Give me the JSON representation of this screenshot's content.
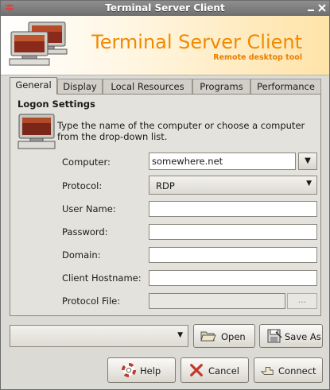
{
  "window": {
    "title": "Terminal Server Client"
  },
  "banner": {
    "title": "Terminal Server Client",
    "subtitle": "Remote desktop tool"
  },
  "tabs": [
    {
      "label": "General",
      "active": true
    },
    {
      "label": "Display",
      "active": false
    },
    {
      "label": "Local Resources",
      "active": false
    },
    {
      "label": "Programs",
      "active": false
    },
    {
      "label": "Performance",
      "active": false
    }
  ],
  "logon": {
    "section_title": "Logon Settings",
    "info": "Type the name of the computer or choose a computer from the drop-down list.",
    "fields": {
      "computer": {
        "label": "Computer:",
        "value": "somewhere.net"
      },
      "protocol": {
        "label": "Protocol:",
        "value": "RDP"
      },
      "username": {
        "label": "User Name:",
        "value": ""
      },
      "password": {
        "label": "Password:",
        "value": ""
      },
      "domain": {
        "label": "Domain:",
        "value": ""
      },
      "client_hostname": {
        "label": "Client Hostname:",
        "value": ""
      },
      "protocol_file": {
        "label": "Protocol File:",
        "value": "",
        "browse_label": "..."
      }
    }
  },
  "profile": {
    "value": "",
    "open_label": "Open",
    "saveas_label": "Save As"
  },
  "buttons": {
    "help": "Help",
    "cancel": "Cancel",
    "connect": "Connect"
  },
  "icons": {
    "window_menu": "window-menu-icon",
    "minimize": "minimize-icon",
    "close": "close-icon",
    "banner": "computers-icon",
    "info": "computer-icon",
    "open": "folder-open-icon",
    "save": "save-icon",
    "help": "help-buoy-icon",
    "cancel": "cancel-x-icon",
    "connect": "connect-hand-icon"
  },
  "colors": {
    "accent": "#f08a00"
  }
}
